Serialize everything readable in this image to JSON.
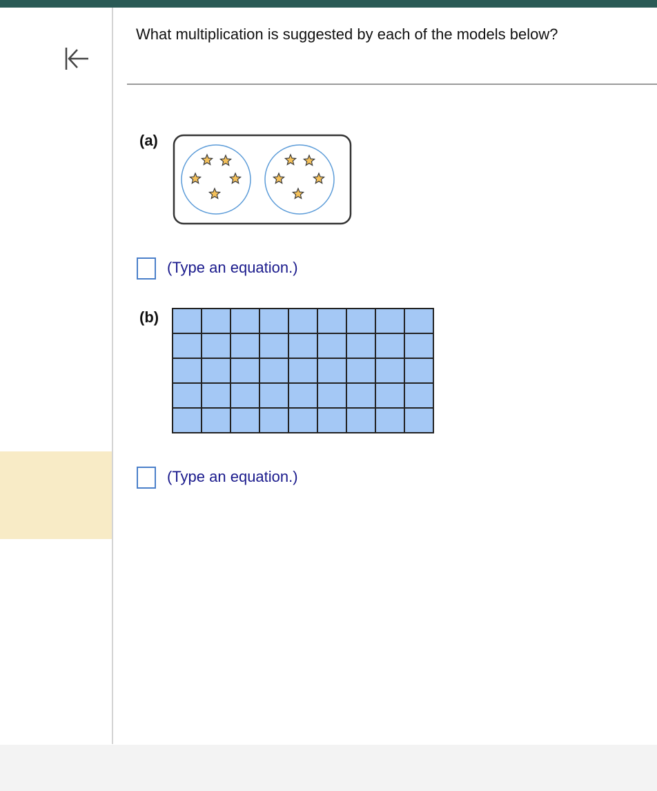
{
  "question": {
    "text": "What multiplication is suggested by each of the models below?"
  },
  "part_a": {
    "label": "(a)",
    "model": {
      "type": "equal-groups",
      "groups": 2,
      "stars_per_group": 5,
      "star_color": "#f5c15a",
      "circle_color": "#5b9bd8"
    },
    "answer": {
      "value": "",
      "hint": "(Type an equation.)"
    }
  },
  "part_b": {
    "label": "(b)",
    "model": {
      "type": "array-grid",
      "rows": 5,
      "columns": 9,
      "cell_color": "#a4c8f5"
    },
    "answer": {
      "value": "",
      "hint": "(Type an equation.)"
    }
  },
  "colors": {
    "top_bar": "#2a5a55",
    "highlight": "#f8ebc6",
    "hint_text": "#1a1a8c",
    "answer_border": "#4a7fc9"
  },
  "icons": {
    "collapse": "collapse-left-arrow-icon"
  }
}
